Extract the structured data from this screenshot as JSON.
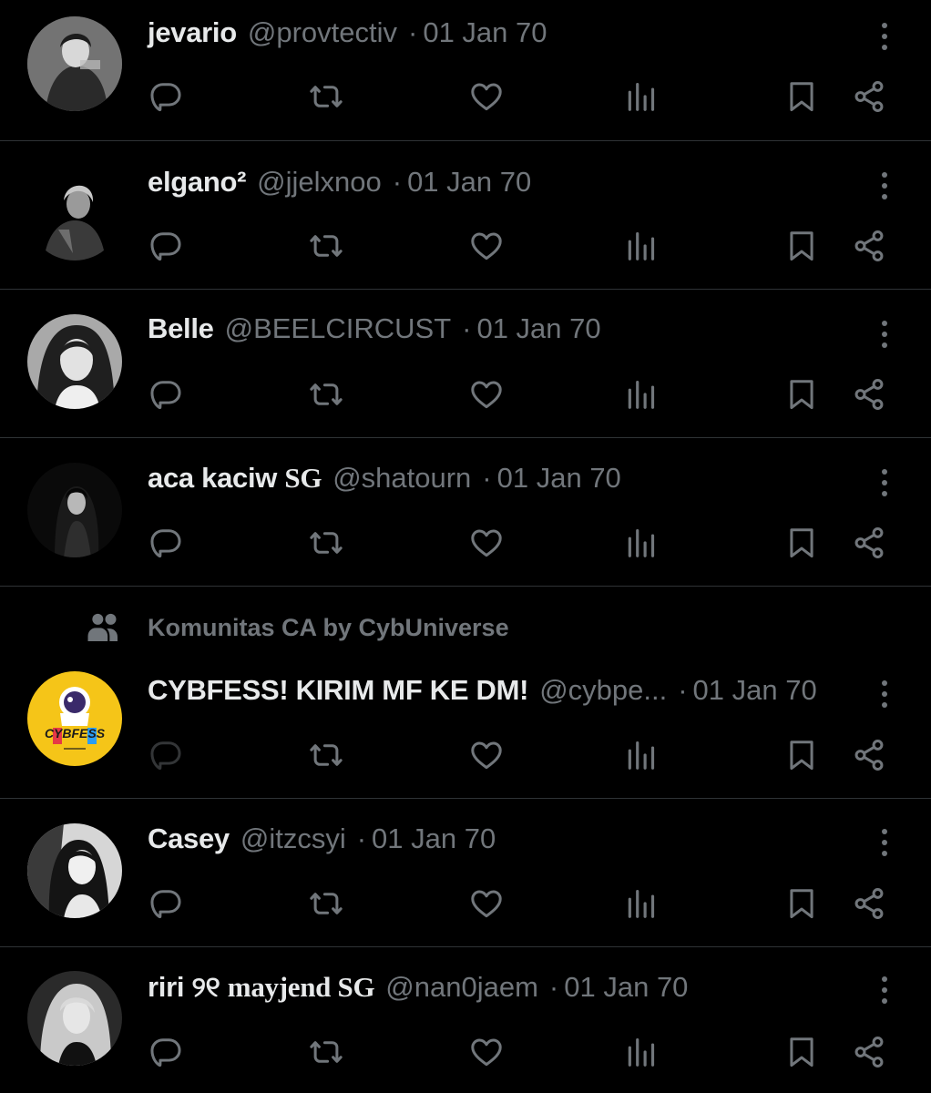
{
  "colors": {
    "background": "#000000",
    "text_primary": "#e7e9ea",
    "text_secondary": "#71767b",
    "divider": "#2f3336"
  },
  "icons": {
    "reply": "reply-icon",
    "repost": "repost-icon",
    "like": "like-icon",
    "views": "views-icon",
    "bookmark": "bookmark-icon",
    "share": "share-icon",
    "more": "more-icon",
    "community": "community-icon"
  },
  "posts": [
    {
      "display_name": "jevario",
      "handle": "@provtectiv",
      "separator": "·",
      "date": "01 Jan 70"
    },
    {
      "display_name": "elgano²",
      "handle": "@jjelxnoo",
      "separator": "·",
      "date": "01 Jan 70"
    },
    {
      "display_name": "Belle",
      "handle": "@BEELCIRCUST",
      "separator": "·",
      "date": "01 Jan 70"
    },
    {
      "display_name": "aca kaciw",
      "name_suffix": "SG",
      "handle": "@shatourn",
      "separator": "·",
      "date": "01 Jan 70"
    },
    {
      "community_label": "Komunitas CA by CybUniverse",
      "display_name": "CYBFESS! KIRIM MF KE DM!",
      "handle": "@cybpe...",
      "separator": "·",
      "date": "01 Jan 70",
      "avatar_text": "CYBFESS"
    },
    {
      "display_name": "Casey",
      "handle": "@itzcsyi",
      "separator": "·",
      "date": "01 Jan 70"
    },
    {
      "display_name": "riri ୨୧",
      "name_suffix": "mayjend SG",
      "handle": "@nan0jaem",
      "separator": "·",
      "date": "01 Jan 70"
    }
  ]
}
